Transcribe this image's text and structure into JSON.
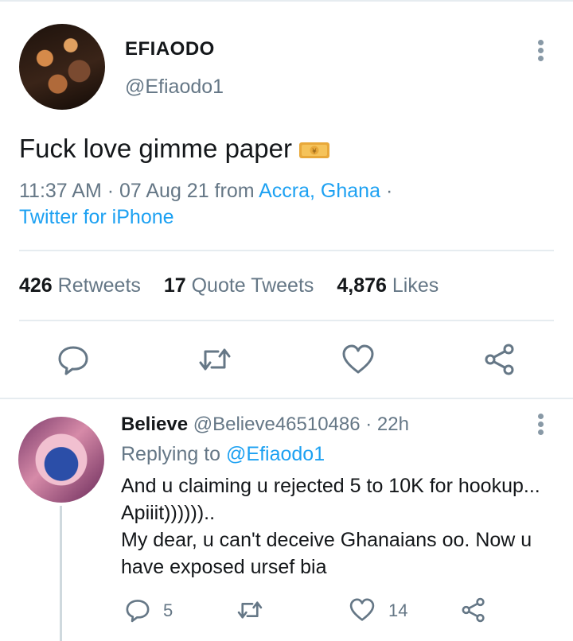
{
  "tweet": {
    "display_name": "EFIAODO",
    "handle": "@Efiaodo1",
    "text": "Fuck love gimme paper",
    "emoji": "money-with-wings-emoji",
    "time": "11:37 AM · 07 Aug 21 from",
    "location": "Accra, Ghana",
    "separator": "·",
    "client": "Twitter for iPhone",
    "stats": {
      "retweets_count": "426",
      "retweets_label": "Retweets",
      "quote_count": "17",
      "quote_label": "Quote Tweets",
      "likes_count": "4,876",
      "likes_label": "Likes"
    },
    "actions": [
      "reply-icon",
      "retweet-icon",
      "like-icon",
      "share-icon"
    ]
  },
  "reply": {
    "display_name": "Believe",
    "handle": "@Believe46510486",
    "time": "· 22h",
    "replying_prefix": "Replying to",
    "replying_to": "@Efiaodo1",
    "lines": [
      "And u claiming u rejected 5 to 10K for hookup...",
      "Apiiit))))))..",
      "My dear, u can't deceive Ghanaians oo. Now u",
      "have exposed ursef bia"
    ],
    "reply_count": "5",
    "like_count": "14"
  },
  "colors": {
    "accent": "#1da1f2",
    "secondary_text": "#657786",
    "icon": "#657786",
    "divider": "#e6ecf0"
  }
}
